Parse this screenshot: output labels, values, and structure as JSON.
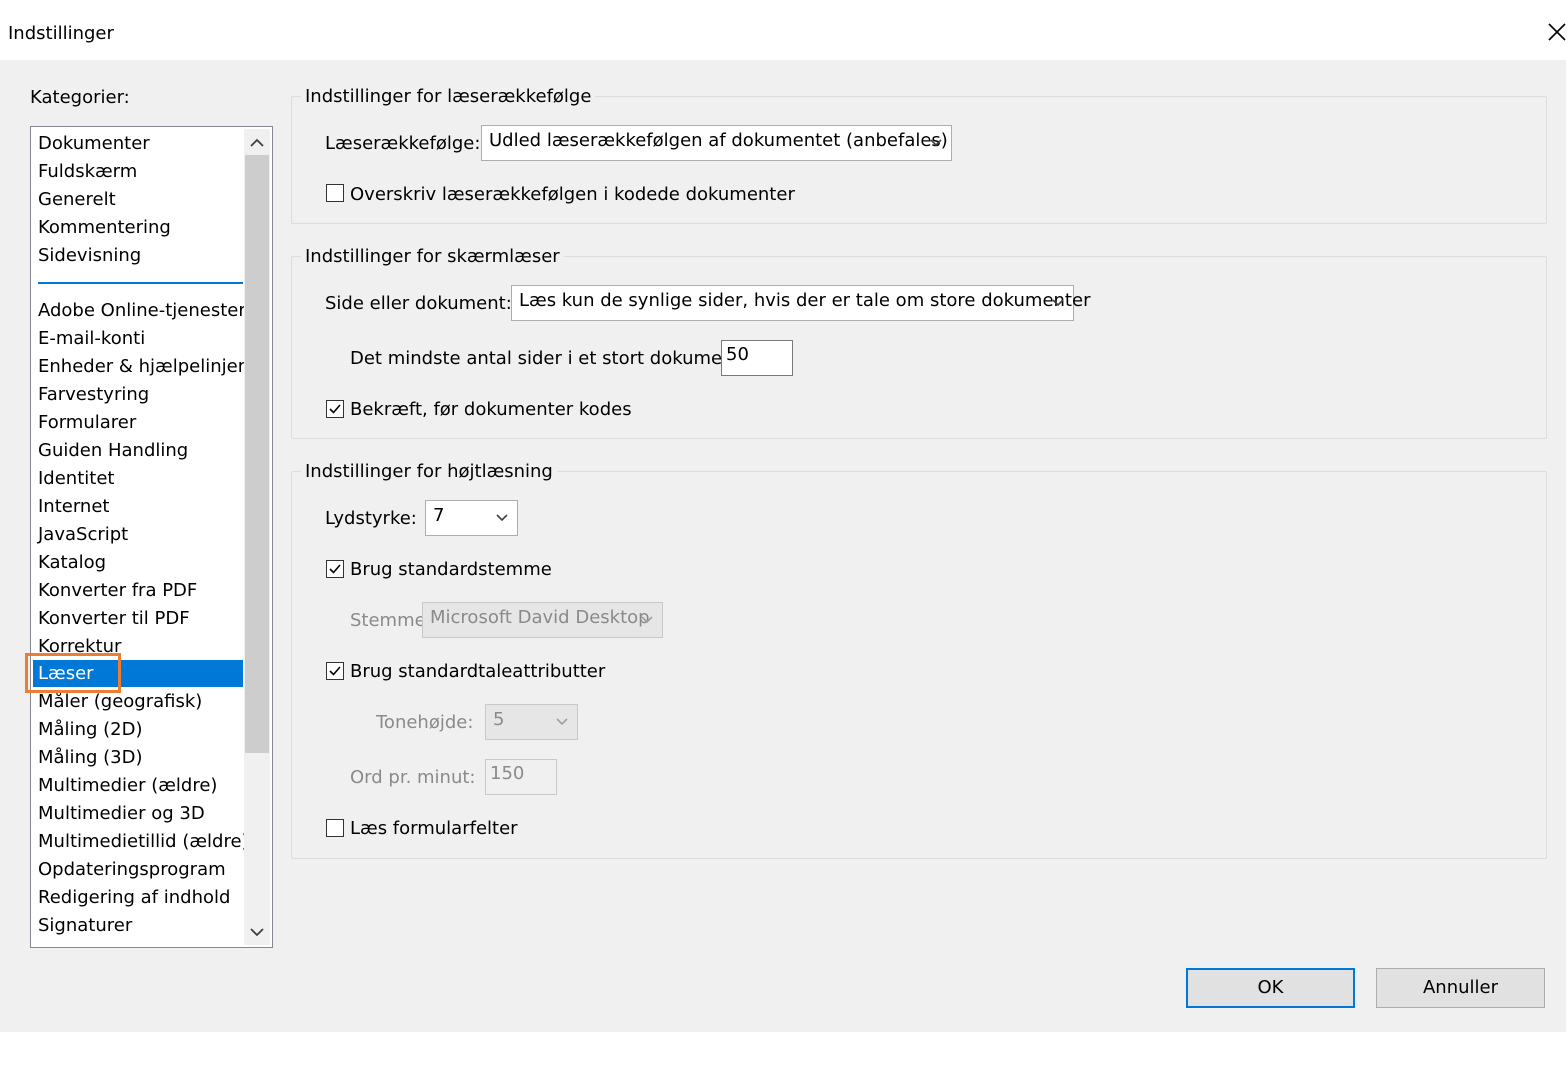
{
  "window": {
    "title": "Indstillinger"
  },
  "categories": {
    "label": "Kategorier:",
    "top_items": [
      "Dokumenter",
      "Fuldskærm",
      "Generelt",
      "Kommentering",
      "Sidevisning"
    ],
    "items": [
      "Adobe Online-tjenester",
      "E-mail-konti",
      "Enheder & hjælpelinjer",
      "Farvestyring",
      "Formularer",
      "Guiden Handling",
      "Identitet",
      "Internet",
      "JavaScript",
      "Katalog",
      "Konverter fra PDF",
      "Konverter til PDF",
      "Korrektur",
      "Læser",
      "Måler (geografisk)",
      "Måling (2D)",
      "Måling (3D)",
      "Multimedier (ældre)",
      "Multimedier og 3D",
      "Multimedietillid (ældre)",
      "Opdateringsprogram",
      "Redigering af indhold",
      "Signaturer"
    ],
    "selected": "Læser"
  },
  "reading_order": {
    "legend": "Indstillinger for læserækkefølge",
    "order_label": "Læserækkefølge:",
    "order_value": "Udled læserækkefølgen af dokumentet (anbefales)",
    "override_label": "Overskriv læserækkefølgen i kodede dokumenter",
    "override_checked": false
  },
  "screen_reader": {
    "legend": "Indstillinger for skærmlæser",
    "page_label": "Side eller dokument:",
    "page_value": "Læs kun de synlige sider, hvis der er tale om store dokumenter",
    "min_pages_label": "Det mindste antal sider i et stort dokument:",
    "min_pages_value": "50",
    "confirm_label": "Bekræft, før dokumenter kodes",
    "confirm_checked": true
  },
  "read_aloud": {
    "legend": "Indstillinger for højtlæsning",
    "volume_label": "Lydstyrke:",
    "volume_value": "7",
    "default_voice_label": "Brug standardstemme",
    "default_voice_checked": true,
    "voice_label": "Stemme:",
    "voice_value": "Microsoft David Desktop",
    "default_speech_label": "Brug standardtaleattributter",
    "default_speech_checked": true,
    "pitch_label": "Tonehøjde:",
    "pitch_value": "5",
    "wpm_label": "Ord pr. minut:",
    "wpm_value": "150",
    "form_fields_label": "Læs formularfelter",
    "form_fields_checked": false
  },
  "buttons": {
    "ok": "OK",
    "cancel": "Annuller"
  },
  "colors": {
    "selection": "#0078d7",
    "highlight_box": "#ed7d31"
  }
}
